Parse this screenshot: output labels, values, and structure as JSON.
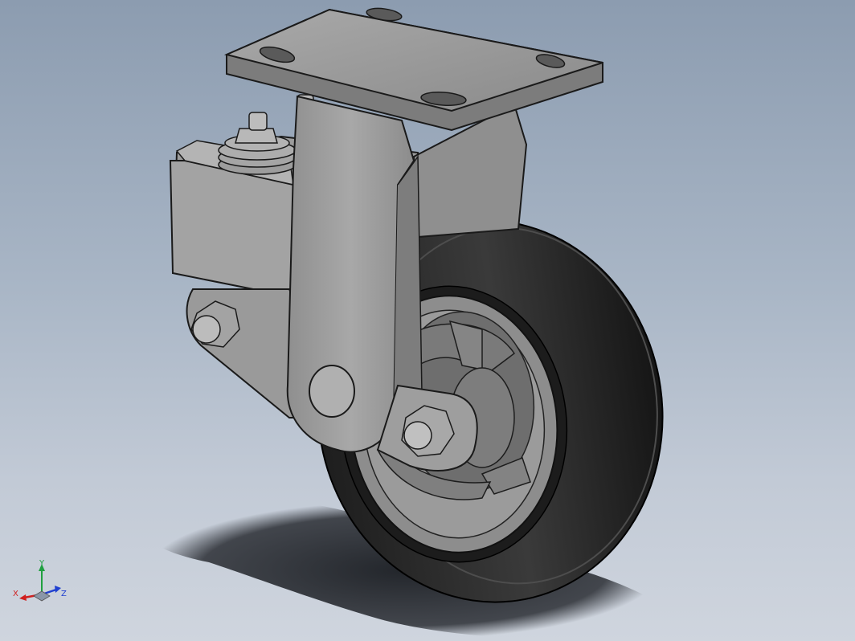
{
  "viewport": {
    "background_top": "#8c9cb0",
    "background_bottom": "#cfd5de"
  },
  "model": {
    "metal_color": "#9a9a9a",
    "tire_color": "#2b2b2b",
    "hub_color": "#8d8d8d"
  },
  "triad": {
    "x_label": "X",
    "y_label": "Y",
    "z_label": "Z",
    "x_color": "#d02020",
    "y_color": "#20a040",
    "z_color": "#2040d0"
  }
}
